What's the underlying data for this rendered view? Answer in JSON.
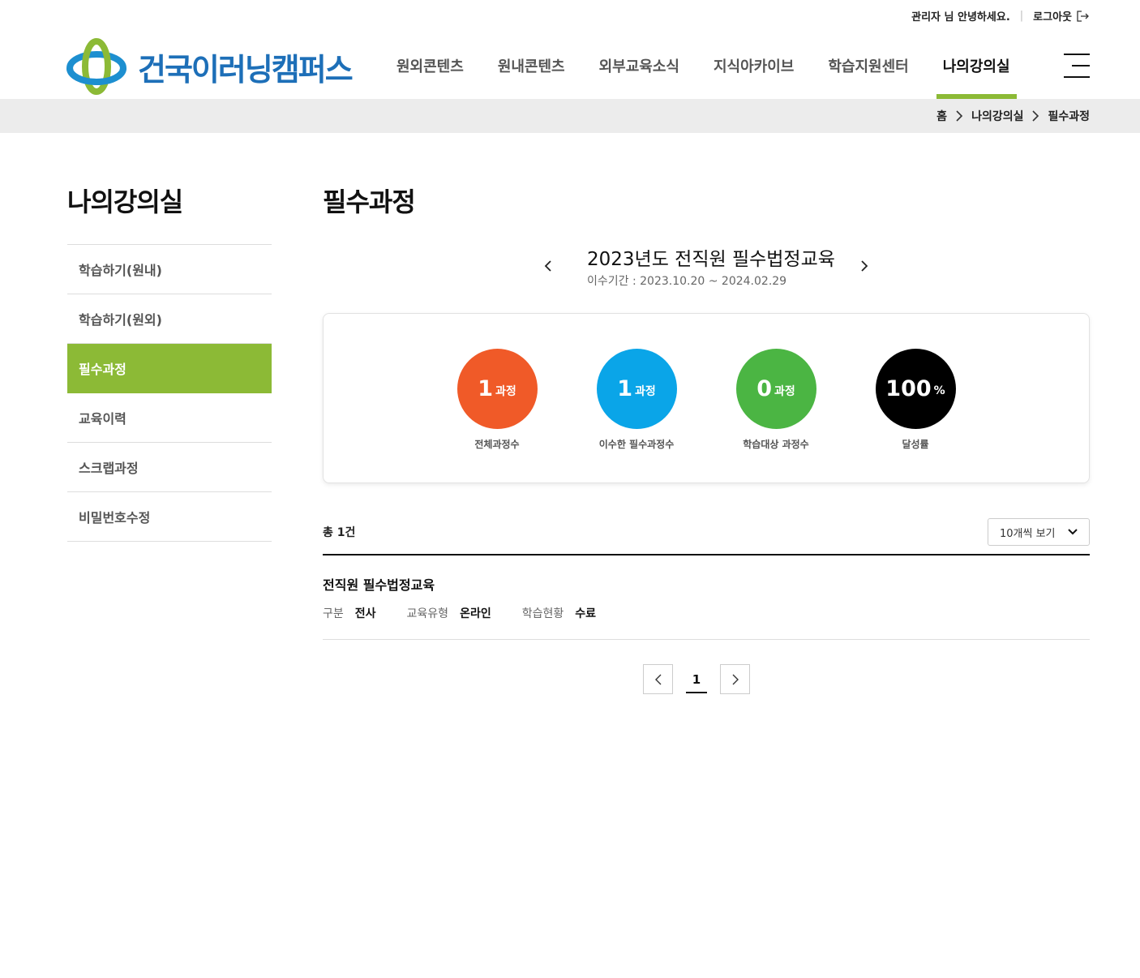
{
  "util": {
    "greeting": "관리자 님 안녕하세요.",
    "logout": "로그아웃"
  },
  "header": {
    "logo_text": "건국이러닝캠퍼스",
    "nav": [
      {
        "label": "원외콘텐츠"
      },
      {
        "label": "원내콘텐츠"
      },
      {
        "label": "외부교육소식"
      },
      {
        "label": "지식아카이브"
      },
      {
        "label": "학습지원센터"
      },
      {
        "label": "나의강의실",
        "active": true
      }
    ]
  },
  "breadcrumb": [
    "홈",
    "나의강의실",
    "필수과정"
  ],
  "sidebar": {
    "title": "나의강의실",
    "items": [
      {
        "label": "학습하기(원내)"
      },
      {
        "label": "학습하기(원외)"
      },
      {
        "label": "필수과정",
        "active": true
      },
      {
        "label": "교육이력"
      },
      {
        "label": "스크랩과정"
      },
      {
        "label": "비밀번호수정"
      }
    ]
  },
  "main": {
    "title": "필수과정",
    "year": {
      "title": "2023년도 전직원 필수법정교육",
      "period": "이수기간 : 2023.10.20 ~ 2024.02.29"
    },
    "stats": [
      {
        "value": "1",
        "unit": "과정",
        "label": "전체과정수",
        "color": "#f05a28"
      },
      {
        "value": "1",
        "unit": "과정",
        "label": "이수한 필수과정수",
        "color": "#0aa5e8"
      },
      {
        "value": "0",
        "unit": "과정",
        "label": "학습대상 과정수",
        "color": "#4bb543"
      },
      {
        "value": "100",
        "unit": "%",
        "label": "달성률",
        "color": "#000000"
      }
    ],
    "total": "총 1건",
    "page_size": "10개씩 보기",
    "rows": [
      {
        "title": "전직원 필수법정교육",
        "meta": [
          {
            "key": "구분",
            "value": "전사"
          },
          {
            "key": "교육유형",
            "value": "온라인"
          },
          {
            "key": "학습현황",
            "value": "수료"
          }
        ]
      }
    ],
    "pagination": {
      "current": "1"
    }
  }
}
